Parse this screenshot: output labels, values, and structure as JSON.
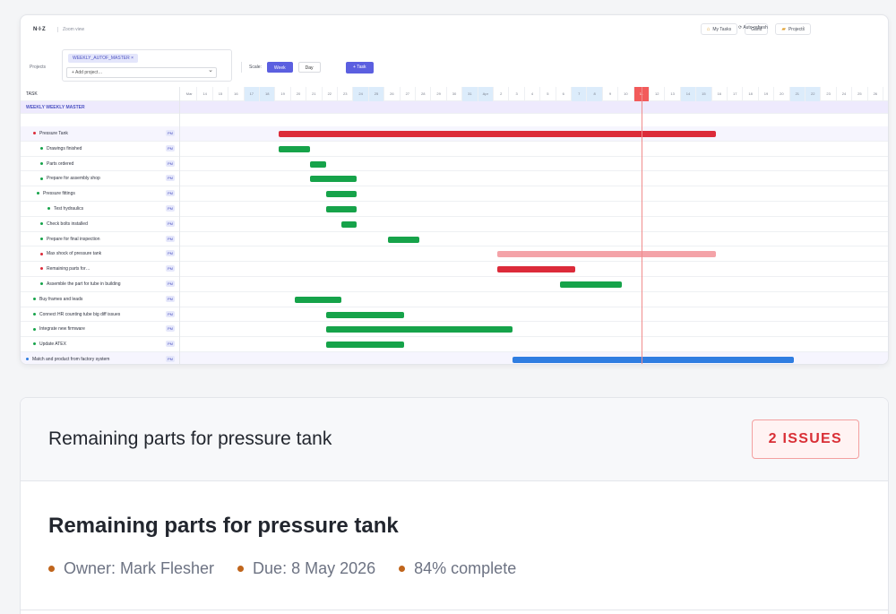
{
  "gantt": {
    "app_title": "N·I·Z",
    "app_link": "Zoom view",
    "nav": {
      "my_tasks": "My Tasks",
      "gantt": "Gantt",
      "projects": "Projects",
      "refresh": "Auto-refresh"
    },
    "projects_label": "Projects",
    "project_chip": "WEEKLY_AUTOF_MASTER",
    "select_placeholder": "+ Add project…",
    "scale_label": "Scale:",
    "scale_week": "Week",
    "scale_day": "Day",
    "add_task": "+ Task",
    "group_header": "TASK",
    "project_row": "WEEKLY WEEKLY MASTER",
    "day_labels": [
      "Mar",
      "14",
      "15",
      "16",
      "17",
      "18",
      "19",
      "20",
      "21",
      "22",
      "23",
      "24",
      "25",
      "26",
      "27",
      "28",
      "29",
      "30",
      "31",
      "Apr",
      "2",
      "3",
      "4",
      "5",
      "6",
      "7",
      "8",
      "9",
      "10",
      "11",
      "12",
      "13",
      "14",
      "15",
      "16",
      "17",
      "18",
      "19",
      "20",
      "21",
      "22",
      "23",
      "24",
      "25",
      "26",
      "27",
      "28",
      "29",
      "30"
    ],
    "tasks": [
      {
        "name": "Pressure Tank",
        "color": "#dc2b3a",
        "tag": "PM"
      },
      {
        "name": "Drawings finished",
        "color": "#16a34a",
        "tag": "PM"
      },
      {
        "name": "Parts ordered",
        "color": "#16a34a",
        "tag": "PM"
      },
      {
        "name": "Prepare for assembly shop",
        "color": "#16a34a",
        "tag": "PM"
      },
      {
        "name": "Pressure fittings",
        "color": "#16a34a",
        "tag": "PM"
      },
      {
        "name": "Test hydraulics",
        "color": "#16a34a",
        "tag": "PM"
      },
      {
        "name": "Check bolts installed",
        "color": "#16a34a",
        "tag": "PM"
      },
      {
        "name": "Prepare for final inspection",
        "color": "#16a34a",
        "tag": "PM"
      },
      {
        "name": "Max shock of pressure tank",
        "color": "#dc2b3a",
        "tag": "PM"
      },
      {
        "name": "Remaining parts for…",
        "color": "#dc2b3a",
        "tag": "PM"
      },
      {
        "name": "Assemble the part for tube in building",
        "color": "#16a34a",
        "tag": "PM"
      },
      {
        "name": "Buy frames and leads",
        "color": "#16a34a",
        "tag": "PM"
      },
      {
        "name": "Connect HR counting tube big diff issues",
        "color": "#16a34a",
        "tag": "PM"
      },
      {
        "name": "Integrate new firmware",
        "color": "#16a34a",
        "tag": "PM"
      },
      {
        "name": "Update ATEX",
        "color": "#16a34a",
        "tag": "PM"
      },
      {
        "name": "Match and product from factory system",
        "color": "#2f7de1",
        "tag": "PM"
      }
    ]
  },
  "detail": {
    "header_title": "Remaining parts for pressure tank",
    "badge": "2 ISSUES",
    "title": "Remaining parts for pressure tank",
    "owner": "Owner: Mark Flesher",
    "due": "Due: 8 May 2026",
    "progress_text": "84% complete",
    "progress_value": 0.84,
    "accent": "#c0651c",
    "badge_color": "#d92f36"
  }
}
